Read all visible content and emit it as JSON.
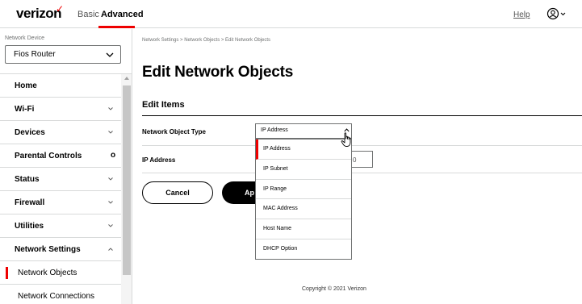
{
  "header": {
    "logo": "verizon",
    "tabs": [
      {
        "label": "Basic",
        "active": false
      },
      {
        "label": "Advanced",
        "active": true
      }
    ],
    "help_label": "Help",
    "accent_color": "#ee0000"
  },
  "sidebar": {
    "device_label": "Network Device",
    "device_value": "Fios Router",
    "items": [
      {
        "label": "Home",
        "icon": ""
      },
      {
        "label": "Wi-Fi",
        "icon": "chevron-down-icon"
      },
      {
        "label": "Devices",
        "icon": "chevron-down-icon"
      },
      {
        "label": "Parental Controls",
        "badge": "o"
      },
      {
        "label": "Status",
        "icon": "chevron-down-icon"
      },
      {
        "label": "Firewall",
        "icon": "chevron-down-icon"
      },
      {
        "label": "Utilities",
        "icon": "chevron-down-icon"
      },
      {
        "label": "Network Settings",
        "icon": "chevron-up-icon"
      }
    ],
    "sub_items": [
      {
        "label": "Network Objects",
        "active": true
      },
      {
        "label": "Network Connections",
        "active": false
      }
    ]
  },
  "main": {
    "breadcrumb": "Network Settings  >  Network Objects  >  Edit Network Objects",
    "title": "Edit Network Objects",
    "section_title": "Edit Items",
    "fields": {
      "object_type_label": "Network Object Type",
      "object_type_value": "IP Address",
      "ip_label": "IP Address",
      "ip_value_tail": "0"
    },
    "buttons": {
      "cancel": "Cancel",
      "apply": "Ap"
    },
    "dropdown_options": [
      {
        "label": "IP Address",
        "selected": true
      },
      {
        "label": "IP Subnet",
        "selected": false
      },
      {
        "label": "IP Range",
        "selected": false
      },
      {
        "label": "MAC Address",
        "selected": false
      },
      {
        "label": "Host Name",
        "selected": false
      },
      {
        "label": "DHCP Option",
        "selected": false
      }
    ]
  },
  "footer": {
    "copyright": "Copyright © 2021 Verizon"
  }
}
